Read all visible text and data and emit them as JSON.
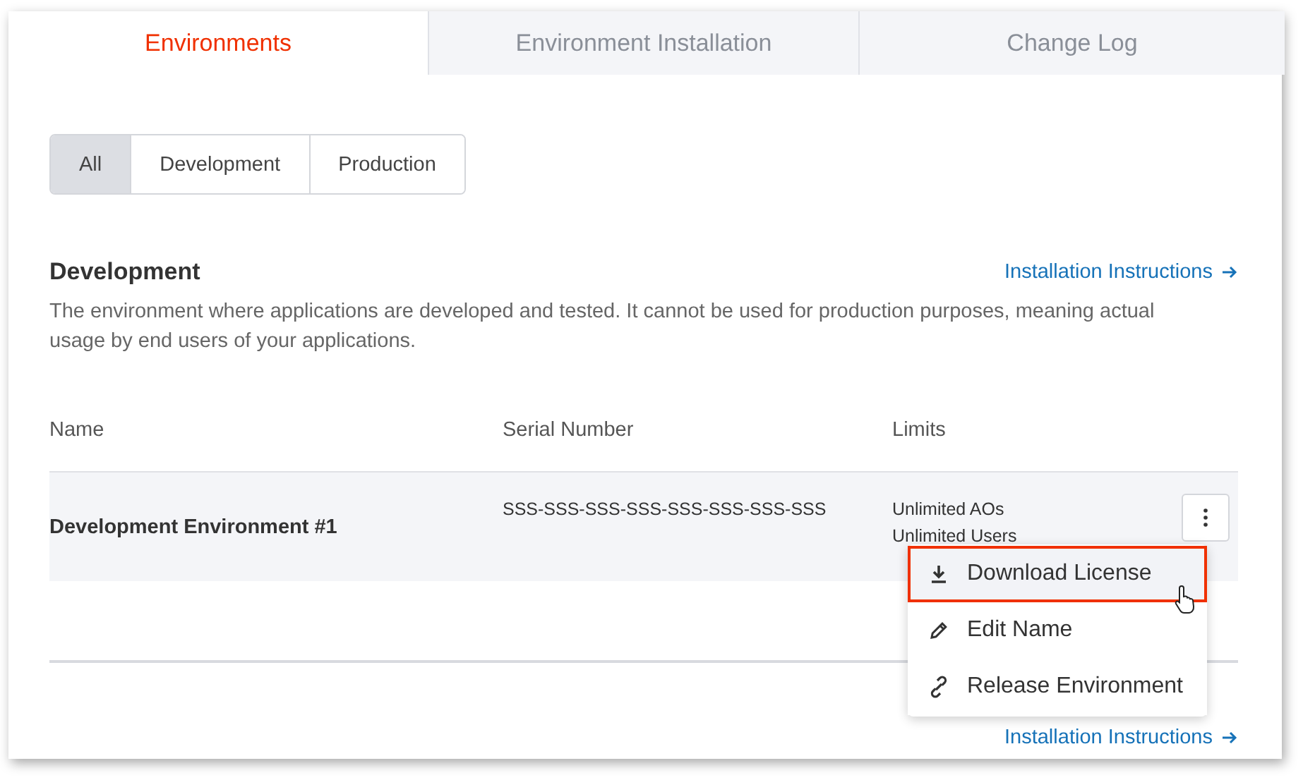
{
  "tabs": [
    {
      "label": "Environments",
      "selected": true
    },
    {
      "label": "Environment Installation",
      "selected": false
    },
    {
      "label": "Change Log",
      "selected": false
    }
  ],
  "filters": [
    {
      "label": "All",
      "selected": true
    },
    {
      "label": "Development",
      "selected": false
    },
    {
      "label": "Production",
      "selected": false
    }
  ],
  "section": {
    "title": "Development",
    "link": "Installation Instructions",
    "description": "The environment where applications are developed and tested. It cannot be used for production purposes, meaning actual usage by end users of your applications."
  },
  "table": {
    "columns": [
      "Name",
      "Serial Number",
      "Limits"
    ],
    "rows": [
      {
        "name": "Development Environment #1",
        "serial": "SSS-SSS-SSS-SSS-SSS-SSS-SSS-SSS",
        "limits": [
          "Unlimited AOs",
          "Unlimited Users"
        ]
      }
    ]
  },
  "menu": [
    {
      "kind": "download",
      "label": "Download License",
      "selected": true
    },
    {
      "kind": "edit",
      "label": "Edit Name",
      "selected": false
    },
    {
      "kind": "release",
      "label": "Release Environment",
      "selected": false
    }
  ],
  "next_section": {
    "link": "Installation Instructions"
  }
}
